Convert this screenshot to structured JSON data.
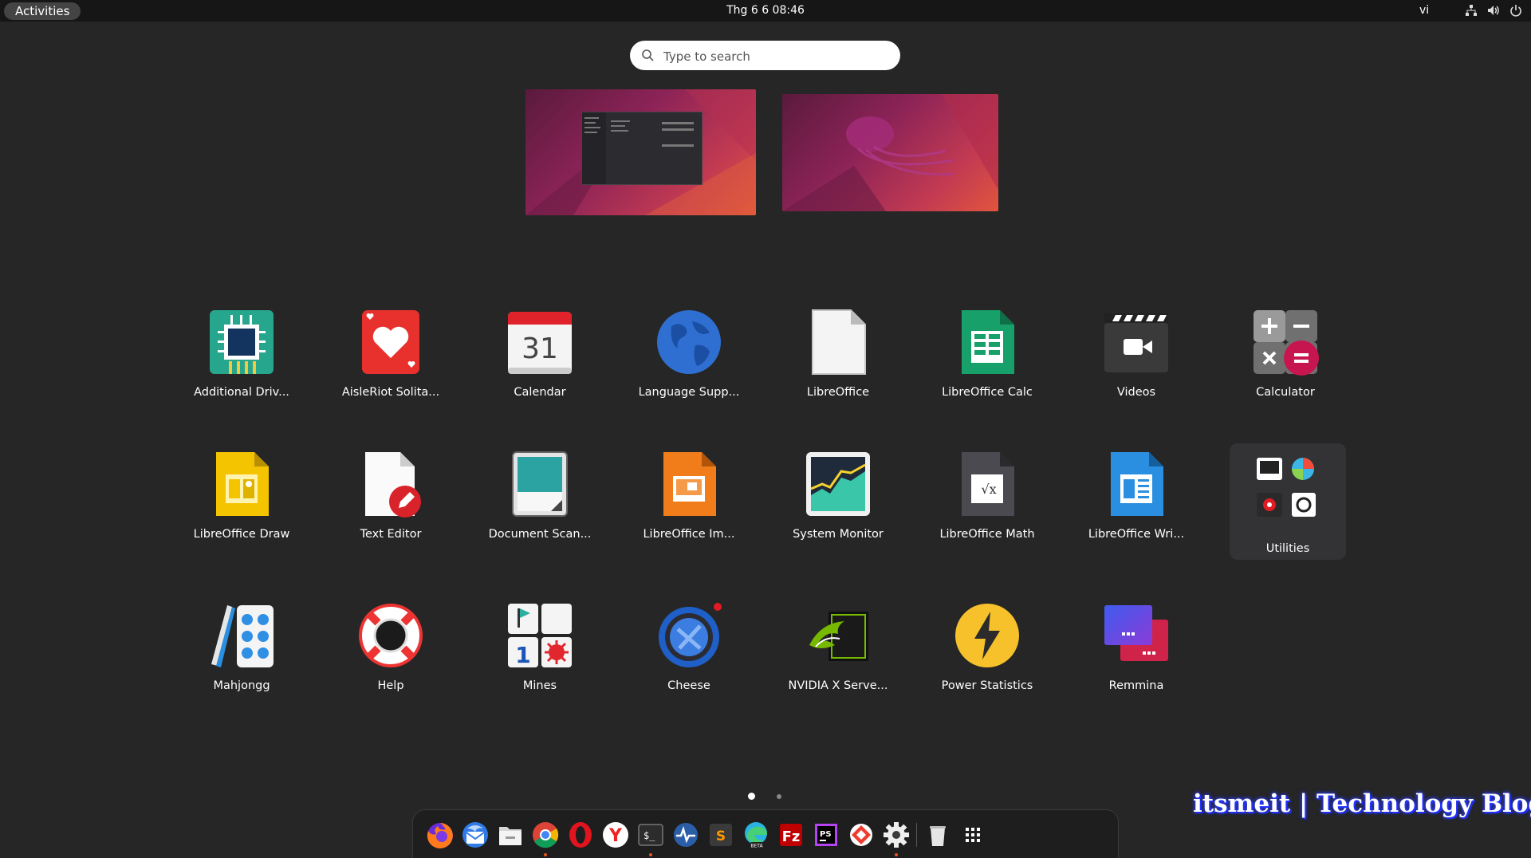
{
  "topbar": {
    "activities_label": "Activities",
    "clock": "Thg 6 6  08:46",
    "keyboard_layout": "vi"
  },
  "search": {
    "placeholder": "Type to search"
  },
  "apps": [
    {
      "label": "Additional Driv...",
      "icon": "chip-icon"
    },
    {
      "label": "AisleRiot Solita...",
      "icon": "heart-card-icon"
    },
    {
      "label": "Calendar",
      "icon": "calendar-icon",
      "day": "31"
    },
    {
      "label": "Language Supp...",
      "icon": "globe-icon"
    },
    {
      "label": "LibreOffice",
      "icon": "libreoffice-icon"
    },
    {
      "label": "LibreOffice Calc",
      "icon": "spreadsheet-icon"
    },
    {
      "label": "Videos",
      "icon": "video-camera-icon"
    },
    {
      "label": "Calculator",
      "icon": "calculator-icon"
    },
    {
      "label": "LibreOffice Draw",
      "icon": "draw-icon"
    },
    {
      "label": "Text Editor",
      "icon": "text-editor-icon"
    },
    {
      "label": "Document Scan...",
      "icon": "scanner-icon"
    },
    {
      "label": "LibreOffice Im...",
      "icon": "impress-icon"
    },
    {
      "label": "System Monitor",
      "icon": "system-monitor-icon"
    },
    {
      "label": "LibreOffice Math",
      "icon": "math-icon"
    },
    {
      "label": "LibreOffice Wri...",
      "icon": "writer-icon"
    },
    {
      "label": "Utilities",
      "icon": "folder-grid-icon"
    },
    {
      "label": "Mahjongg",
      "icon": "mahjongg-icon"
    },
    {
      "label": "Help",
      "icon": "lifebuoy-icon"
    },
    {
      "label": "Mines",
      "icon": "mines-icon",
      "digit": "1"
    },
    {
      "label": "Cheese",
      "icon": "webcam-icon"
    },
    {
      "label": "NVIDIA X Serve...",
      "icon": "nvidia-icon"
    },
    {
      "label": "Power Statistics",
      "icon": "lightning-icon"
    },
    {
      "label": "Remmina",
      "icon": "remote-desktop-icon"
    }
  ],
  "pages": {
    "count": 2,
    "current": 1
  },
  "dock": [
    {
      "name": "firefox-icon",
      "running": false
    },
    {
      "name": "thunderbird-icon",
      "running": false
    },
    {
      "name": "files-icon",
      "running": false
    },
    {
      "name": "chrome-icon",
      "running": true
    },
    {
      "name": "opera-icon",
      "running": false
    },
    {
      "name": "yandex-icon",
      "running": false
    },
    {
      "name": "terminal-icon",
      "running": true
    },
    {
      "name": "monitor-wave-icon",
      "running": false
    },
    {
      "name": "sublime-icon",
      "running": false
    },
    {
      "name": "edge-beta-icon",
      "running": false
    },
    {
      "name": "filezilla-icon",
      "running": false
    },
    {
      "name": "phpstorm-icon",
      "running": false
    },
    {
      "name": "anydesk-icon",
      "running": false
    },
    {
      "name": "settings-icon",
      "running": true
    },
    {
      "name": "trash-icon",
      "running": false
    },
    {
      "name": "show-apps-icon",
      "running": false
    }
  ],
  "dock_labels": {
    "sublime": "S",
    "phpstorm": "PS",
    "edge_badge": "BETA",
    "terminal": "$_"
  },
  "watermark": "itsmeit | Technology Blogs"
}
